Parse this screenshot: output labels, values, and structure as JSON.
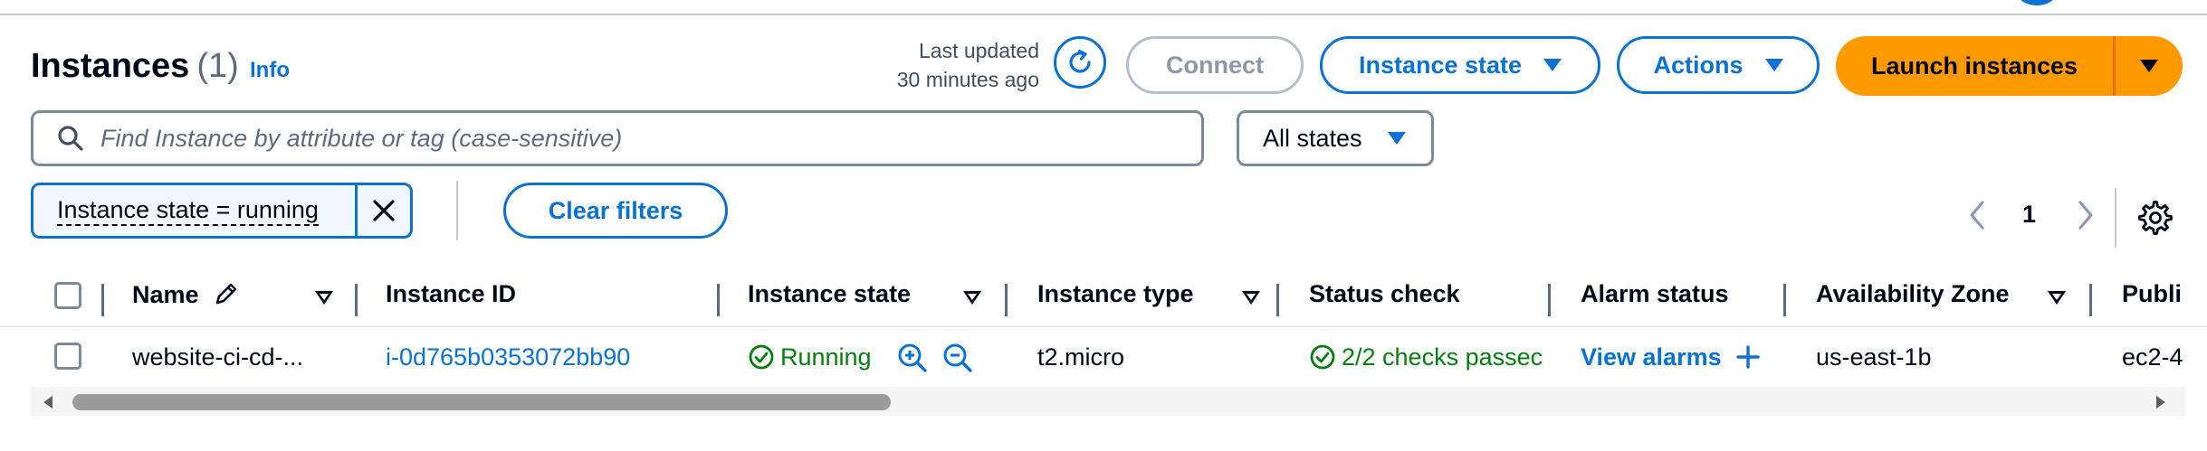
{
  "header": {
    "title": "Instances",
    "count": "(1)",
    "info_link": "Info",
    "last_updated_line1": "Last updated",
    "last_updated_line2": "30 minutes ago"
  },
  "toolbar": {
    "connect_label": "Connect",
    "instance_state_label": "Instance state",
    "actions_label": "Actions",
    "launch_label": "Launch instances"
  },
  "search": {
    "placeholder": "Find Instance by attribute or tag (case-sensitive)",
    "value": ""
  },
  "state_filter": {
    "selected": "All states"
  },
  "filters": {
    "tokens": [
      "Instance state = running"
    ],
    "clear_label": "Clear filters"
  },
  "pagination": {
    "current_page": "1"
  },
  "table": {
    "columns": [
      "Name",
      "Instance ID",
      "Instance state",
      "Instance type",
      "Status check",
      "Alarm status",
      "Availability Zone",
      "Publi"
    ],
    "rows": [
      {
        "name": "website-ci-cd-...",
        "instance_id": "i-0d765b0353072bb90",
        "instance_state": "Running",
        "instance_type": "t2.micro",
        "status_check": "2/2 checks passec",
        "alarm_status": "View alarms",
        "availability_zone": "us-east-1b",
        "public": "ec2-4"
      }
    ]
  },
  "colors": {
    "accent": "#0972d3",
    "primary_button": "#ff9900",
    "success": "#037f0c",
    "disabled": "#8d99a8"
  },
  "icons": [
    "refresh-icon",
    "caret-down-icon",
    "search-icon",
    "close-icon",
    "chevron-left-icon",
    "chevron-right-icon",
    "gear-icon",
    "pencil-icon",
    "status-positive-icon",
    "zoom-in-icon",
    "zoom-out-icon",
    "plus-icon"
  ]
}
